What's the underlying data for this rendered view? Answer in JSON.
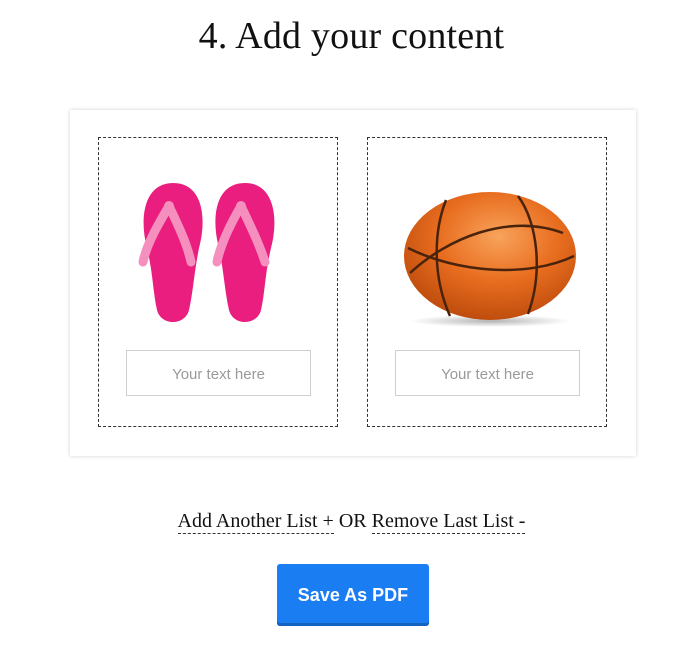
{
  "page": {
    "title": "4. Add your content"
  },
  "cards": [
    {
      "icon": "flip-flops-icon",
      "placeholder": "Your text here"
    },
    {
      "icon": "basketball-icon",
      "placeholder": "Your text here"
    }
  ],
  "actions": {
    "add_label": "Add Another List +",
    "or_label": "OR",
    "remove_label": "Remove Last List -"
  },
  "save_button": {
    "label": "Save As PDF"
  },
  "colors": {
    "button": "#1a7ef2",
    "flipflop": "#e91e7f",
    "strap": "#f48fbe",
    "ball": "#e86d1f"
  }
}
